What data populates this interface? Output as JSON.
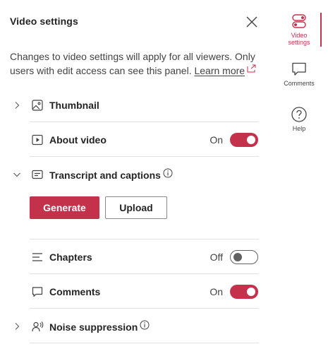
{
  "panel": {
    "title": "Video settings",
    "intro_text": "Changes to video settings will apply for all viewers. Only users with edit access can see this panel.",
    "learn_more": "Learn more"
  },
  "rows": {
    "thumbnail": {
      "label": "Thumbnail"
    },
    "about_video": {
      "label": "About video",
      "state": "On"
    },
    "transcript": {
      "label": "Transcript and captions"
    },
    "chapters": {
      "label": "Chapters",
      "state": "Off"
    },
    "comments": {
      "label": "Comments",
      "state": "On"
    },
    "noise": {
      "label": "Noise suppression"
    }
  },
  "buttons": {
    "generate": "Generate",
    "upload": "Upload"
  },
  "rail": {
    "video_settings": "Video settings",
    "comments": "Comments",
    "help": "Help"
  },
  "colors": {
    "accent": "#c4314b",
    "text": "#242424",
    "divider": "#e1e1e1"
  }
}
